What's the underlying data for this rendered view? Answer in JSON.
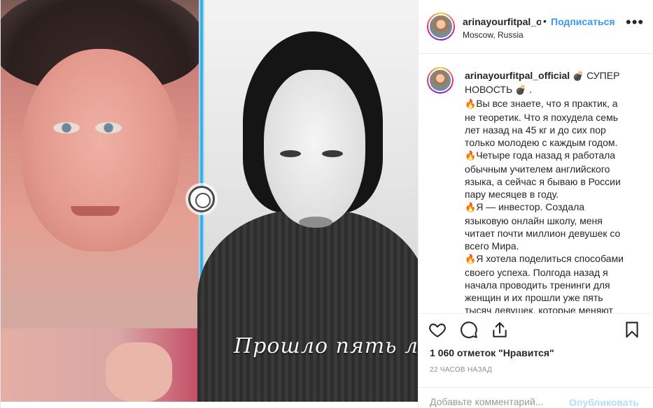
{
  "post": {
    "author": {
      "username": "arinayourfitpal_official",
      "username_truncated": "arinayourfitpal_o",
      "location": "Moscow, Russia"
    },
    "header": {
      "follow_label": "Подписаться",
      "separator": "•",
      "more_label": "•••"
    },
    "media": {
      "overlay_text": "Прошло пять лет..."
    },
    "caption": {
      "username": "arinayourfitpal_official",
      "title_part1": "СУПЕР",
      "title_part2": "НОВОСТЬ",
      "title_end": ".",
      "bomb_emoji": "💣",
      "fire_emoji": "🔥",
      "para1": "Вы все знаете, что я практик, а не теоретик. Что я похудела семь лет назад на 45 кг и до сих пор только молодею с каждым годом.",
      "para2": "Четыре года назад я работала обычным учителем английского языка, а сейчас я бываю в России пару месяцев в году.",
      "para3": "Я — инвестор. Создала языковую онлайн школу, меня читает почти миллион девушек со всего Мира.",
      "para4": "Я хотела поделиться способами своего успеха. Полгода назад я начала проводить тренинги для женщин и их прошли уже пять тысяч девушек, которые меняют свои жизни и начинают верить в себя."
    },
    "likes_text": "1 060 отметок \"Нравится\"",
    "timestamp": "22 часов назад",
    "comment_input": {
      "placeholder": "Добавьте комментарий...",
      "value": ""
    },
    "publish_label": "Опубликовать",
    "colors": {
      "link_blue": "#3897f0",
      "publish_disabled": "#b2dffc",
      "divider_blue": "#1aa0dc"
    },
    "icons": [
      "heart-icon",
      "comment-icon",
      "share-icon",
      "bookmark-icon",
      "more-icon"
    ]
  }
}
